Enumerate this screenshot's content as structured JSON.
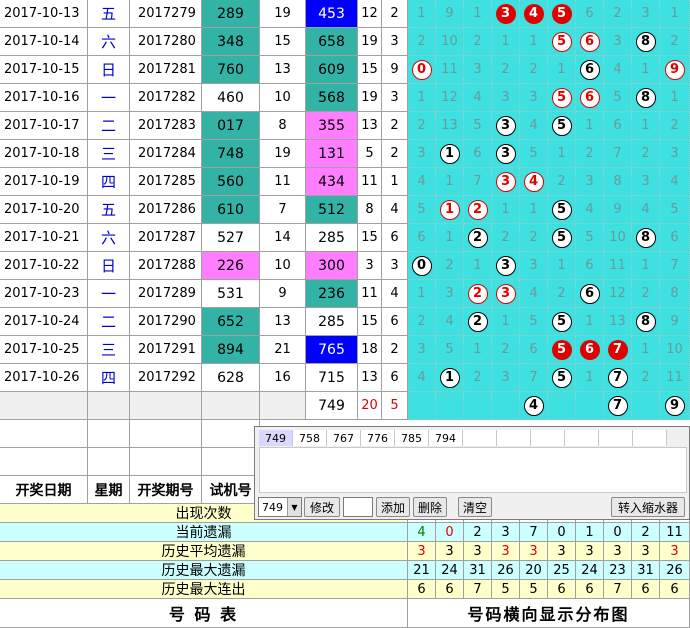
{
  "rows": [
    {
      "date": "2017-10-13",
      "week": "五",
      "issue": "2017279",
      "trial": "289",
      "trial_hl": "teal",
      "a": "19",
      "num": "453",
      "num_hl": "blue",
      "b": "12",
      "c": "2",
      "dist": [
        {
          "t": "1"
        },
        {
          "t": "9"
        },
        {
          "t": "1"
        },
        {
          "t": "3",
          "s": "red"
        },
        {
          "t": "4",
          "s": "red"
        },
        {
          "t": "5",
          "s": "red"
        },
        {
          "t": "6"
        },
        {
          "t": "2"
        },
        {
          "t": "3"
        },
        {
          "t": "1"
        }
      ]
    },
    {
      "date": "2017-10-14",
      "week": "六",
      "issue": "2017280",
      "trial": "348",
      "trial_hl": "teal",
      "a": "15",
      "num": "658",
      "num_hl": "teal",
      "b": "19",
      "c": "3",
      "dist": [
        {
          "t": "2"
        },
        {
          "t": "10"
        },
        {
          "t": "2"
        },
        {
          "t": "1"
        },
        {
          "t": "1"
        },
        {
          "t": "5",
          "s": "white-red"
        },
        {
          "t": "6",
          "s": "white-red"
        },
        {
          "t": "3"
        },
        {
          "t": "8",
          "s": "white"
        },
        {
          "t": "2"
        }
      ]
    },
    {
      "date": "2017-10-15",
      "week": "日",
      "issue": "2017281",
      "trial": "760",
      "trial_hl": "teal",
      "a": "13",
      "num": "609",
      "num_hl": "teal",
      "b": "15",
      "c": "9",
      "dist": [
        {
          "t": "0",
          "s": "white-red"
        },
        {
          "t": "11"
        },
        {
          "t": "3"
        },
        {
          "t": "2"
        },
        {
          "t": "2"
        },
        {
          "t": "1"
        },
        {
          "t": "6",
          "s": "white"
        },
        {
          "t": "4"
        },
        {
          "t": "1"
        },
        {
          "t": "9",
          "s": "white-red"
        }
      ]
    },
    {
      "date": "2017-10-16",
      "week": "一",
      "issue": "2017282",
      "trial": "460",
      "trial_hl": "",
      "a": "10",
      "num": "568",
      "num_hl": "teal",
      "b": "19",
      "c": "3",
      "dist": [
        {
          "t": "1"
        },
        {
          "t": "12"
        },
        {
          "t": "4"
        },
        {
          "t": "3"
        },
        {
          "t": "3"
        },
        {
          "t": "5",
          "s": "white-red"
        },
        {
          "t": "6",
          "s": "white-red"
        },
        {
          "t": "5"
        },
        {
          "t": "8",
          "s": "white"
        },
        {
          "t": "1"
        }
      ]
    },
    {
      "date": "2017-10-17",
      "week": "二",
      "issue": "2017283",
      "trial": "017",
      "trial_hl": "teal",
      "a": "8",
      "num": "355",
      "num_hl": "pink",
      "b": "13",
      "c": "2",
      "dist": [
        {
          "t": "2"
        },
        {
          "t": "13"
        },
        {
          "t": "5"
        },
        {
          "t": "3",
          "s": "white"
        },
        {
          "t": "4"
        },
        {
          "t": "5",
          "s": "white"
        },
        {
          "t": "1"
        },
        {
          "t": "6"
        },
        {
          "t": "1"
        },
        {
          "t": "2"
        }
      ]
    },
    {
      "date": "2017-10-18",
      "week": "三",
      "issue": "2017284",
      "trial": "748",
      "trial_hl": "teal",
      "a": "19",
      "num": "131",
      "num_hl": "pink",
      "b": "5",
      "c": "2",
      "dist": [
        {
          "t": "3"
        },
        {
          "t": "1",
          "s": "white"
        },
        {
          "t": "6"
        },
        {
          "t": "3",
          "s": "white"
        },
        {
          "t": "5"
        },
        {
          "t": "1"
        },
        {
          "t": "2"
        },
        {
          "t": "7"
        },
        {
          "t": "2"
        },
        {
          "t": "3"
        }
      ]
    },
    {
      "date": "2017-10-19",
      "week": "四",
      "issue": "2017285",
      "trial": "560",
      "trial_hl": "teal",
      "a": "11",
      "num": "434",
      "num_hl": "pink",
      "b": "11",
      "c": "1",
      "dist": [
        {
          "t": "4"
        },
        {
          "t": "1"
        },
        {
          "t": "7"
        },
        {
          "t": "3",
          "s": "white-red"
        },
        {
          "t": "4",
          "s": "white-red"
        },
        {
          "t": "2"
        },
        {
          "t": "3"
        },
        {
          "t": "8"
        },
        {
          "t": "3"
        },
        {
          "t": "4"
        }
      ]
    },
    {
      "date": "2017-10-20",
      "week": "五",
      "issue": "2017286",
      "trial": "610",
      "trial_hl": "teal",
      "a": "7",
      "num": "512",
      "num_hl": "teal",
      "b": "8",
      "c": "4",
      "dist": [
        {
          "t": "5"
        },
        {
          "t": "1",
          "s": "white-red"
        },
        {
          "t": "2",
          "s": "white-red"
        },
        {
          "t": "1"
        },
        {
          "t": "1"
        },
        {
          "t": "5",
          "s": "white"
        },
        {
          "t": "4"
        },
        {
          "t": "9"
        },
        {
          "t": "4"
        },
        {
          "t": "5"
        }
      ]
    },
    {
      "date": "2017-10-21",
      "week": "六",
      "issue": "2017287",
      "trial": "527",
      "trial_hl": "",
      "a": "14",
      "num": "285",
      "num_hl": "",
      "b": "15",
      "c": "6",
      "dist": [
        {
          "t": "6"
        },
        {
          "t": "1"
        },
        {
          "t": "2",
          "s": "white"
        },
        {
          "t": "2"
        },
        {
          "t": "2"
        },
        {
          "t": "5",
          "s": "white"
        },
        {
          "t": "5"
        },
        {
          "t": "10"
        },
        {
          "t": "8",
          "s": "white"
        },
        {
          "t": "6"
        }
      ]
    },
    {
      "date": "2017-10-22",
      "week": "日",
      "issue": "2017288",
      "trial": "226",
      "trial_hl": "pink",
      "a": "10",
      "num": "300",
      "num_hl": "pink",
      "b": "3",
      "c": "3",
      "dist": [
        {
          "t": "0",
          "s": "white"
        },
        {
          "t": "2"
        },
        {
          "t": "1"
        },
        {
          "t": "3",
          "s": "white"
        },
        {
          "t": "3"
        },
        {
          "t": "1"
        },
        {
          "t": "6"
        },
        {
          "t": "11"
        },
        {
          "t": "1"
        },
        {
          "t": "7"
        }
      ]
    },
    {
      "date": "2017-10-23",
      "week": "一",
      "issue": "2017289",
      "trial": "531",
      "trial_hl": "",
      "a": "9",
      "num": "236",
      "num_hl": "teal",
      "b": "11",
      "c": "4",
      "dist": [
        {
          "t": "1"
        },
        {
          "t": "3"
        },
        {
          "t": "2",
          "s": "white-red"
        },
        {
          "t": "3",
          "s": "white-red"
        },
        {
          "t": "4"
        },
        {
          "t": "2"
        },
        {
          "t": "6",
          "s": "white"
        },
        {
          "t": "12"
        },
        {
          "t": "2"
        },
        {
          "t": "8"
        }
      ]
    },
    {
      "date": "2017-10-24",
      "week": "二",
      "issue": "2017290",
      "trial": "652",
      "trial_hl": "teal",
      "a": "13",
      "num": "285",
      "num_hl": "",
      "b": "15",
      "c": "6",
      "dist": [
        {
          "t": "2"
        },
        {
          "t": "4"
        },
        {
          "t": "2",
          "s": "white"
        },
        {
          "t": "1"
        },
        {
          "t": "5"
        },
        {
          "t": "5",
          "s": "white"
        },
        {
          "t": "1"
        },
        {
          "t": "13"
        },
        {
          "t": "8",
          "s": "white"
        },
        {
          "t": "9"
        }
      ]
    },
    {
      "date": "2017-10-25",
      "week": "三",
      "issue": "2017291",
      "trial": "894",
      "trial_hl": "teal",
      "a": "21",
      "num": "765",
      "num_hl": "blue",
      "b": "18",
      "c": "2",
      "dist": [
        {
          "t": "3"
        },
        {
          "t": "5"
        },
        {
          "t": "1"
        },
        {
          "t": "2"
        },
        {
          "t": "6"
        },
        {
          "t": "5",
          "s": "red"
        },
        {
          "t": "6",
          "s": "red"
        },
        {
          "t": "7",
          "s": "red"
        },
        {
          "t": "1"
        },
        {
          "t": "10"
        }
      ]
    },
    {
      "date": "2017-10-26",
      "week": "四",
      "issue": "2017292",
      "trial": "628",
      "trial_hl": "",
      "a": "16",
      "num": "715",
      "num_hl": "",
      "b": "13",
      "c": "6",
      "dist": [
        {
          "t": "4"
        },
        {
          "t": "1",
          "s": "white"
        },
        {
          "t": "2"
        },
        {
          "t": "3"
        },
        {
          "t": "7"
        },
        {
          "t": "5",
          "s": "white"
        },
        {
          "t": "1"
        },
        {
          "t": "7",
          "s": "white"
        },
        {
          "t": "2"
        },
        {
          "t": "11"
        }
      ]
    }
  ],
  "forecast_row": {
    "num": "749",
    "b": "20",
    "c": "5",
    "dist": [
      {
        "t": ""
      },
      {
        "t": ""
      },
      {
        "t": ""
      },
      {
        "t": ""
      },
      {
        "t": "4",
        "s": "white"
      },
      {
        "t": ""
      },
      {
        "t": ""
      },
      {
        "t": "7",
        "s": "white"
      },
      {
        "t": ""
      },
      {
        "t": "9",
        "s": "white"
      }
    ]
  },
  "headers": {
    "date": "开奖日期",
    "week": "星期",
    "issue": "开奖期号",
    "trial": "试机号"
  },
  "stats": [
    {
      "label": "出现次数",
      "values": []
    },
    {
      "label": "当前遗漏",
      "values": [
        "4",
        "0",
        "2",
        "3",
        "7",
        "0",
        "1",
        "0",
        "2",
        "11"
      ],
      "colors": [
        "#008000",
        "#e00000",
        "#000",
        "#000",
        "#000",
        "#000",
        "#000",
        "#000",
        "#000",
        "#000"
      ]
    },
    {
      "label": "历史平均遗漏",
      "values": [
        "3",
        "3",
        "3",
        "3",
        "3",
        "3",
        "3",
        "3",
        "3",
        "3"
      ],
      "colors": [
        "#e00000",
        "#000",
        "#000",
        "#e00000",
        "#e00000",
        "#000",
        "#000",
        "#000",
        "#000",
        "#e00000"
      ]
    },
    {
      "label": "历史最大遗漏",
      "values": [
        "21",
        "24",
        "31",
        "26",
        "20",
        "25",
        "24",
        "23",
        "31",
        "26"
      ]
    },
    {
      "label": "历史最大连出",
      "values": [
        "6",
        "6",
        "7",
        "5",
        "5",
        "6",
        "6",
        "7",
        "6",
        "6"
      ]
    }
  ],
  "footer": {
    "left": "号 码 表",
    "right": "号码横向显示分布图"
  },
  "panel": {
    "tabs": [
      "749",
      "758",
      "767",
      "776",
      "785",
      "794"
    ],
    "select_value": "749",
    "buttons": {
      "modify": "修改",
      "add": "添加",
      "delete": "删除",
      "clear": "清空",
      "to_filter": "转入缩水器"
    }
  },
  "colors": {
    "teal": "#33b2a6",
    "pink": "#ff7dff",
    "blue": "#0000ff",
    "cyan": "#3fe0e0",
    "red": "#e00000",
    "stat_bg": "#ffffcc",
    "stat_alt": "#ccffff"
  }
}
